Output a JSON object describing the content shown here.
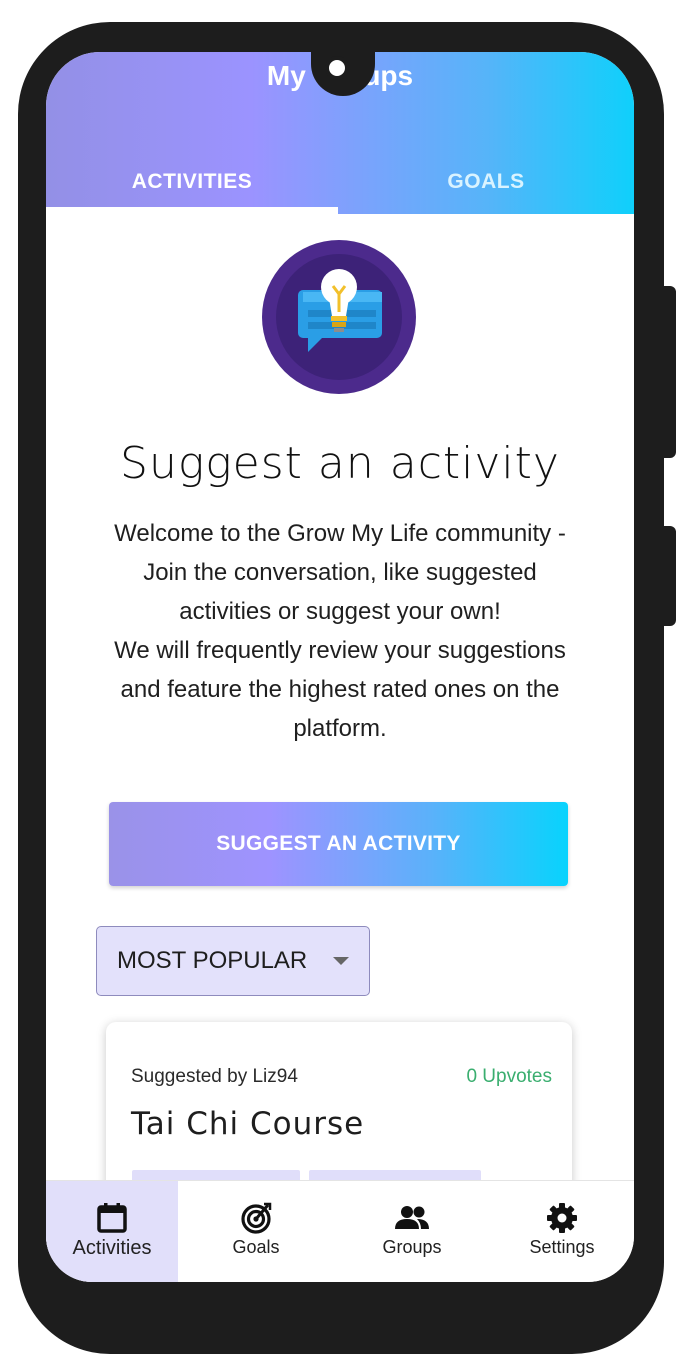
{
  "header": {
    "title": "My Groups",
    "tabs": [
      {
        "label": "ACTIVITIES",
        "selected": true
      },
      {
        "label": "GOALS",
        "selected": false
      }
    ]
  },
  "main": {
    "icon": "lightbulb-chat-icon",
    "heading": "Suggest an activity",
    "intro_lines": [
      "Welcome to the Grow My Life community -",
      "Join the conversation, like suggested",
      "activities or suggest your own!",
      "We will frequently review your suggestions",
      "and feature the highest rated ones on the",
      "platform."
    ],
    "suggest_button": "SUGGEST AN ACTIVITY",
    "sort": {
      "selected": "MOST POPULAR",
      "icon": "caret-down-icon"
    },
    "cards": [
      {
        "suggested_by": "Suggested by Liz94",
        "upvotes": "0 Upvotes",
        "title": "Tai Chi Course"
      }
    ]
  },
  "bottom_nav": [
    {
      "label": "Activities",
      "icon": "calendar-icon",
      "active": true
    },
    {
      "label": "Goals",
      "icon": "target-icon",
      "active": false
    },
    {
      "label": "Groups",
      "icon": "people-icon",
      "active": false
    },
    {
      "label": "Settings",
      "icon": "gear-icon",
      "active": false
    }
  ],
  "colors": {
    "gradient_start": "#9b93ff",
    "gradient_end": "#0fd0fb",
    "active_nav_bg": "#e1dffa",
    "upvote_green": "#3aae6f",
    "badge_purple": "#4c2a8c"
  }
}
